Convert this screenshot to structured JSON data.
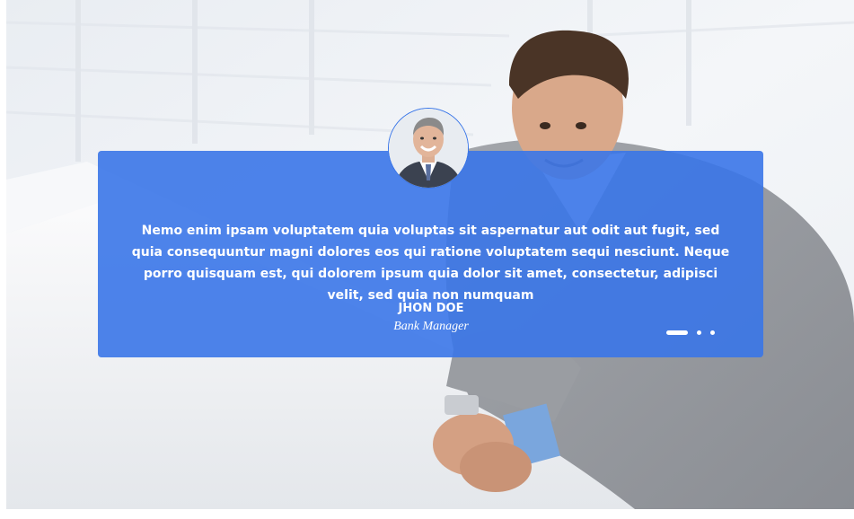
{
  "testimonial": {
    "quote": "Nemo enim ipsam voluptatem quia voluptas sit aspernatur aut odit aut fugit, sed quia consequuntur magni dolores eos qui ratione voluptatem sequi nesciunt. Neque porro quisquam est, qui dolorem ipsum quia dolor sit amet, consectetur, adipisci velit, sed quia non numquam",
    "author_name": "JHON DOE",
    "author_role": "Bank Manager"
  },
  "carousel": {
    "slide_count": 3,
    "active_slide": 1
  },
  "colors": {
    "card_accent": "#3a76e8",
    "text": "#ffffff"
  },
  "icons": {
    "avatar": "author-photo",
    "background": "businessman-photo"
  }
}
